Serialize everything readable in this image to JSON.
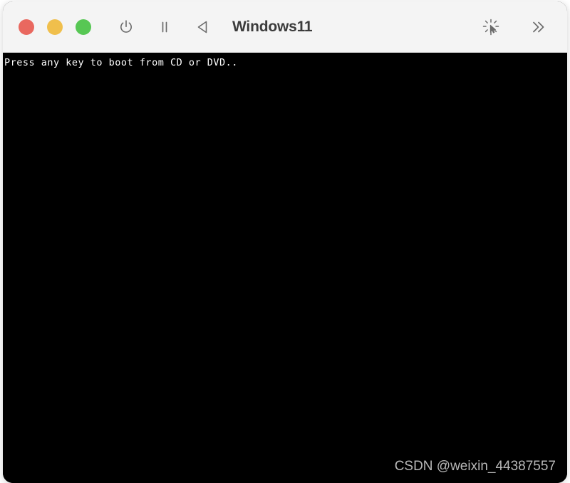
{
  "window": {
    "title": "Windows11",
    "controls": [
      {
        "name": "close",
        "color": "#e9685f"
      },
      {
        "name": "minimize",
        "color": "#f0bf4c"
      },
      {
        "name": "maximize",
        "color": "#57c754"
      }
    ],
    "toolbar_left": [
      {
        "icon": "power-icon",
        "label": "Power"
      },
      {
        "icon": "pause-icon",
        "label": "Pause"
      },
      {
        "icon": "back-triangle-icon",
        "label": "Back"
      }
    ],
    "toolbar_right": [
      {
        "icon": "pointer-capture-icon",
        "label": "Capture Input"
      },
      {
        "icon": "double-chevron-right-icon",
        "label": "More"
      }
    ]
  },
  "guest": {
    "boot_message": "Press any key to boot from CD or DVD..",
    "background_color": "#000000",
    "text_color": "#ffffff"
  },
  "watermark": {
    "text": "CSDN @weixin_44387557",
    "color": "#b8b8b8"
  }
}
